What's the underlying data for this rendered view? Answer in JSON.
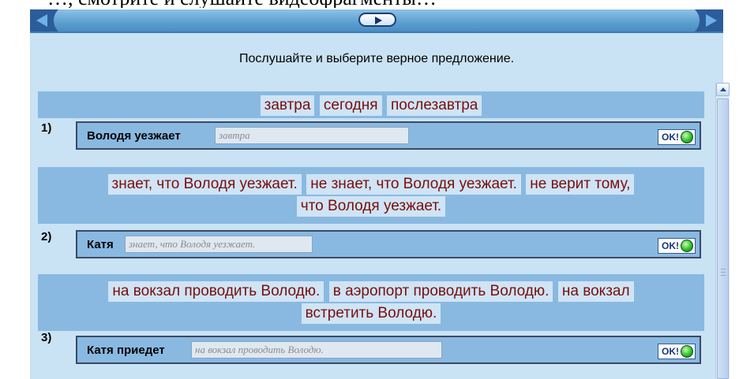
{
  "top_fragment": "…, смотрите и слушайте видеофрагменты…",
  "nav": {
    "prev_icon": "prev-arrow-icon",
    "play_icon": "play-icon",
    "next_icon": "next-arrow-icon"
  },
  "instruction": "Послушайте и выберите верное предложение.",
  "questions": [
    {
      "number": "1)",
      "options": [
        "завтра",
        "сегодня",
        "послезавтра"
      ],
      "subject": "Володя уезжает",
      "answer": "завтра",
      "ok_label": "OK!"
    },
    {
      "number": "2)",
      "options": [
        "знает, что Володя уезжает.",
        "не знает, что Володя уезжает.",
        "не верит тому,",
        "что Володя уезжает."
      ],
      "subject": "Катя",
      "answer": "знает, что Володя уезжает.",
      "ok_label": "OK!"
    },
    {
      "number": "3)",
      "options": [
        "на вокзал проводить Володю.",
        "в аэропорт проводить Володю.",
        "на вокзал",
        "встретить Володю."
      ],
      "subject": "Катя приедет",
      "answer": "на вокзал проводить Володю.",
      "ok_label": "OK!"
    }
  ],
  "colors": {
    "panel_bg": "#c9e2f4",
    "band_bg": "#89b9e1",
    "chip_text": "#7a0d0d",
    "led_green": "#2fbd2f"
  }
}
